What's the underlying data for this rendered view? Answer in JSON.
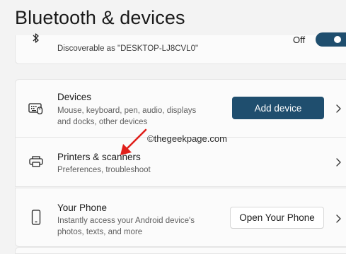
{
  "page": {
    "title": "Bluetooth & devices"
  },
  "bluetooth_row": {
    "subtitle": "Discoverable as \"DESKTOP-LJ8CVL0\"",
    "toggle_label": "Off",
    "icon": "bluetooth-icon"
  },
  "devices_row": {
    "title": "Devices",
    "subtitle_line1": "Mouse, keyboard, pen, audio, displays",
    "subtitle_line2": "and docks, other devices",
    "button_label": "Add device",
    "icon": "keyboard-mouse-icon"
  },
  "printers_row": {
    "title": "Printers & scanners",
    "subtitle": "Preferences, troubleshoot",
    "icon": "printer-icon"
  },
  "phone_row": {
    "title": "Your Phone",
    "subtitle_line1": "Instantly access your Android device's",
    "subtitle_line2": "photos, texts, and more",
    "button_label": "Open Your Phone",
    "icon": "phone-icon"
  },
  "watermark": {
    "text": "©thegeekpage.com"
  },
  "colors": {
    "accent": "#1f4e6e",
    "background": "#f3f3f3",
    "card": "#fbfbfb",
    "annotation_arrow": "#e0201b"
  }
}
